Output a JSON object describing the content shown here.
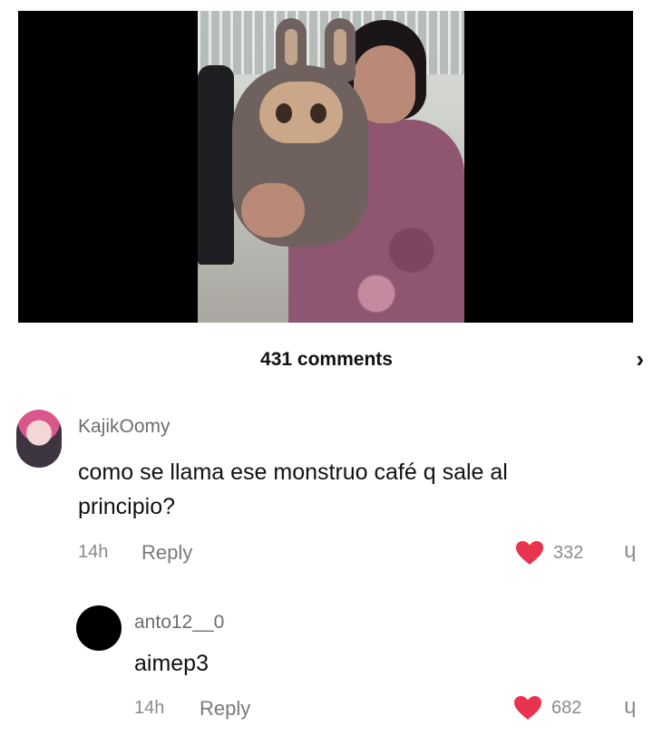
{
  "video": {
    "description_icon": "video-thumbnail"
  },
  "header": {
    "comments_count": "431 comments",
    "next_icon": "chevron-right-icon"
  },
  "comments": [
    {
      "username": "KajikOomy",
      "text_line1": "como se llama ese monstruo café q sale al",
      "text_line2": "principio?",
      "time": "14h",
      "reply_label": "Reply",
      "likes": "332"
    },
    {
      "username": "anto12__0",
      "text_line1": "aimep3",
      "time": "14h",
      "reply_label": "Reply",
      "likes": "682"
    }
  ],
  "colors": {
    "heart": "#e8344e",
    "text": "#111111",
    "muted": "#8a8a8a"
  }
}
